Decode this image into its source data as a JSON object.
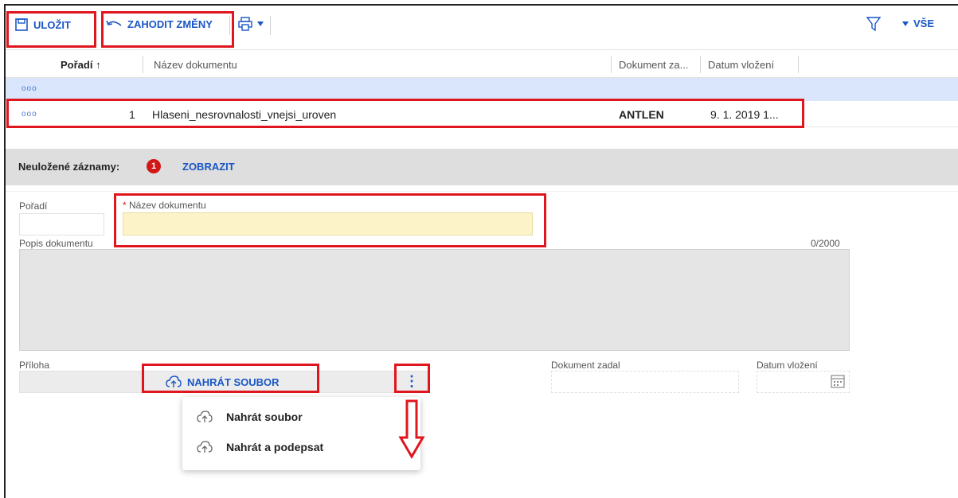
{
  "toolbar": {
    "save_label": "ULOŽIT",
    "discard_label": "ZAHODIT ZMĚNY",
    "filter_all_label": "VŠE"
  },
  "grid": {
    "columns": [
      "Pořadí ↑",
      "Název dokumentu",
      "Dokument za...",
      "Datum vložení"
    ],
    "rows": [
      {
        "order": "1",
        "name": "Hlaseni_nesrovnalosti_vnejsi_uroven",
        "entered_by": "ANTLEN",
        "date": "9. 1. 2019 1..."
      }
    ],
    "row_menu": "ooo"
  },
  "unsaved": {
    "label": "Neuložené záznamy:",
    "count": "1",
    "show_label": "ZOBRAZIT"
  },
  "form": {
    "order_label": "Pořadí",
    "name_required_mark": "*",
    "name_label": "Název dokumentu",
    "name_value": "",
    "description_label": "Popis dokumentu",
    "description_counter": "0/2000",
    "attachment_label": "Příloha",
    "upload_label": "NAHRÁT SOUBOR",
    "entered_by_label": "Dokument zadal",
    "date_label": "Datum vložení"
  },
  "menu": {
    "items": [
      {
        "label": "Nahrát soubor",
        "icon": "cloud-upload-icon"
      },
      {
        "label": "Nahrát a podepsat",
        "icon": "cloud-upload-icon"
      }
    ]
  },
  "colors": {
    "accent": "#1a56c4",
    "highlight": "#e0161f",
    "selected_row": "#d9e6fb",
    "required_field": "#fdf3c8"
  }
}
